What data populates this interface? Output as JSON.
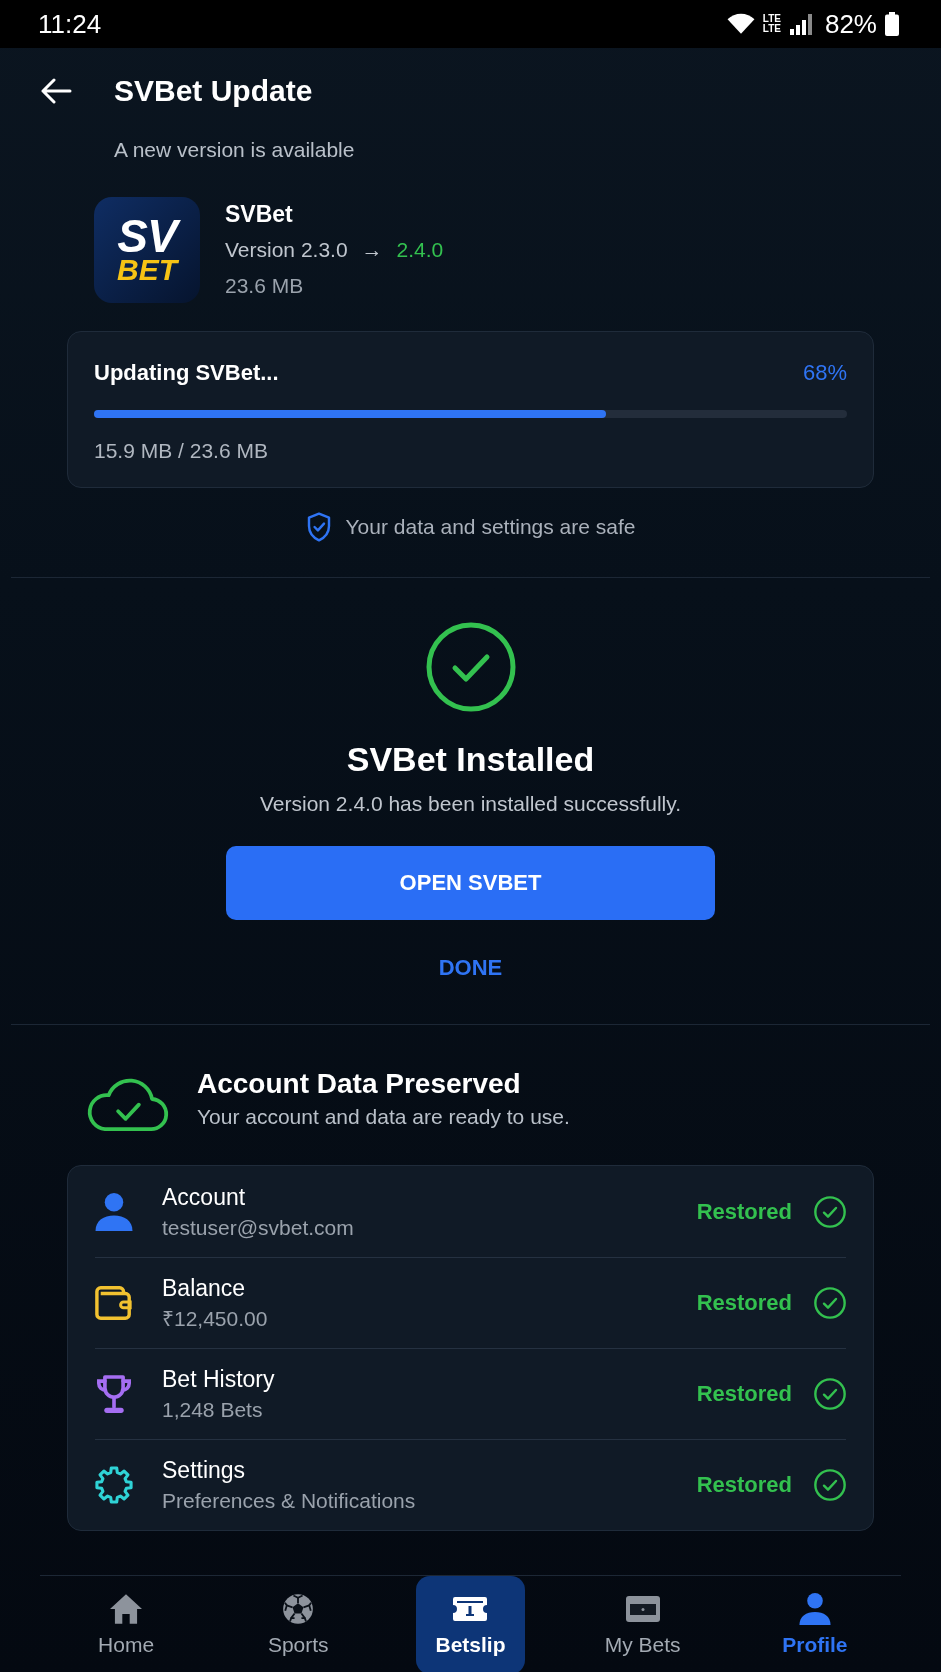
{
  "status_bar": {
    "time": "11:24",
    "network": [
      "LTE",
      "LTE"
    ],
    "battery": "82%"
  },
  "header": {
    "title": "SVBet Update",
    "subtitle": "A new version is available"
  },
  "app": {
    "logo": {
      "top": "SV",
      "bottom": "BET"
    },
    "name": "SVBet",
    "current_version": "Version 2.3.0",
    "arrow": "→",
    "new_version": "2.4.0",
    "size": "23.6 MB"
  },
  "progress": {
    "label": "Updating SVBet...",
    "percent": "68%",
    "level": 0.68,
    "downloaded": "15.9 MB / 23.6 MB"
  },
  "safety_note": "Your data and settings are safe",
  "installed": {
    "title": "SVBet Installed",
    "message": "Version 2.4.0 has been installed successfully.",
    "primary_button": "OPEN SVBET",
    "secondary_button": "DONE"
  },
  "preserved": {
    "title": "Account Data Preserved",
    "subtitle": "Your account and data are ready to use.",
    "items": [
      {
        "kind": "account",
        "title": "Account",
        "detail": "testuser@svbet.com",
        "status": "Restored"
      },
      {
        "kind": "balance",
        "title": "Balance",
        "detail": "₹12,450.00",
        "status": "Restored"
      },
      {
        "kind": "history",
        "title": "Bet History",
        "detail": "1,248 Bets",
        "status": "Restored"
      },
      {
        "kind": "settings",
        "title": "Settings",
        "detail": "Preferences & Notifications",
        "status": "Restored"
      }
    ]
  },
  "nav": [
    {
      "kind": "home",
      "label": "Home",
      "selected": false,
      "featured": false
    },
    {
      "kind": "sports",
      "label": "Sports",
      "selected": false,
      "featured": false
    },
    {
      "kind": "betslip",
      "label": "Betslip",
      "selected": false,
      "featured": true
    },
    {
      "kind": "bets",
      "label": "My Bets",
      "selected": false,
      "featured": false
    },
    {
      "kind": "profile",
      "label": "Profile",
      "selected": true,
      "featured": false
    }
  ]
}
